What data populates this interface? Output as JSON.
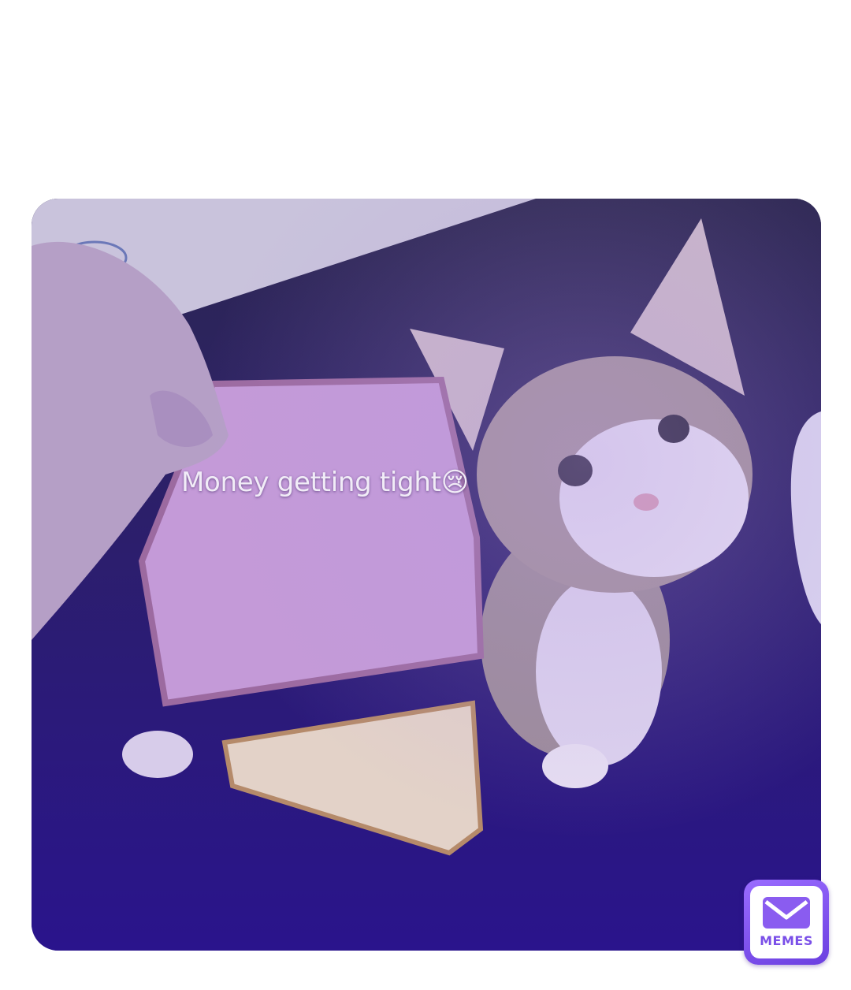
{
  "meme": {
    "caption": "Money getting tight",
    "caption_emoji": "😢",
    "photo_subject": "kitten-with-bread-slices",
    "tint_color": "#3b2a9a"
  },
  "watermark": {
    "label": "MEMES",
    "icon": "envelope-icon",
    "accent_color": "#7a4fe8"
  }
}
